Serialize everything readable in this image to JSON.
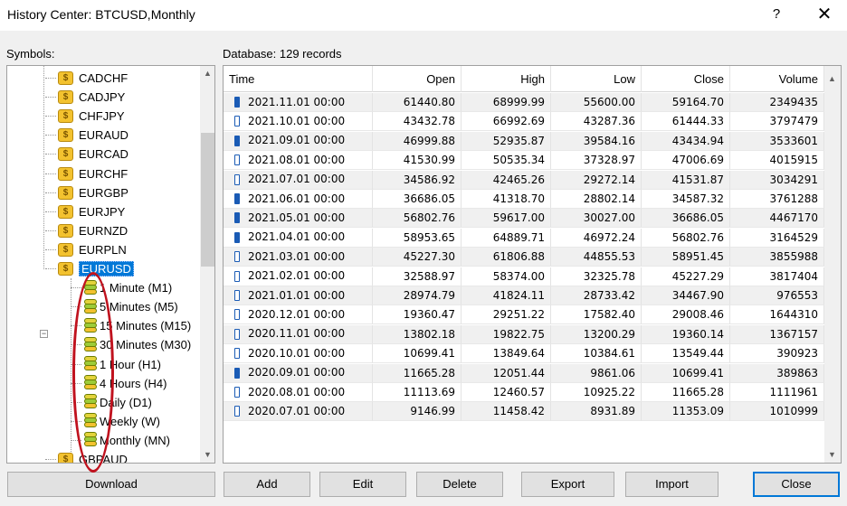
{
  "window": {
    "title": "History Center: BTCUSD,Monthly",
    "help_label": "?",
    "close_label": "✕"
  },
  "symbols_label": "Symbols:",
  "database_label": "Database: 129 records",
  "tree": {
    "symbols_above": [
      "CADCHF",
      "CADJPY",
      "CHFJPY",
      "EURAUD",
      "EURCAD",
      "EURCHF",
      "EURGBP",
      "EURJPY",
      "EURNZD",
      "EURPLN"
    ],
    "selected_symbol": "EURUSD",
    "timeframes": [
      "1 Minute (M1)",
      "5 Minutes (M5)",
      "15 Minutes (M15)",
      "30 Minutes (M30)",
      "1 Hour (H1)",
      "4 Hours (H4)",
      "Daily (D1)",
      "Weekly (W)",
      "Monthly (MN)"
    ],
    "symbol_below": "GBPAUD",
    "coin_glyph": "$",
    "expander_glyph": "−",
    "scroll_up": "▲",
    "scroll_down": "▼"
  },
  "grid": {
    "columns": [
      "Time",
      "Open",
      "High",
      "Low",
      "Close",
      "Volume"
    ],
    "rows": [
      [
        "2021.11.01 00:00",
        "61440.80",
        "68999.99",
        "55600.00",
        "59164.70",
        "2349435"
      ],
      [
        "2021.10.01 00:00",
        "43432.78",
        "66992.69",
        "43287.36",
        "61444.33",
        "3797479"
      ],
      [
        "2021.09.01 00:00",
        "46999.88",
        "52935.87",
        "39584.16",
        "43434.94",
        "3533601"
      ],
      [
        "2021.08.01 00:00",
        "41530.99",
        "50535.34",
        "37328.97",
        "47006.69",
        "4015915"
      ],
      [
        "2021.07.01 00:00",
        "34586.92",
        "42465.26",
        "29272.14",
        "41531.87",
        "3034291"
      ],
      [
        "2021.06.01 00:00",
        "36686.05",
        "41318.70",
        "28802.14",
        "34587.32",
        "3761288"
      ],
      [
        "2021.05.01 00:00",
        "56802.76",
        "59617.00",
        "30027.00",
        "36686.05",
        "4467170"
      ],
      [
        "2021.04.01 00:00",
        "58953.65",
        "64889.71",
        "46972.24",
        "56802.76",
        "3164529"
      ],
      [
        "2021.03.01 00:00",
        "45227.30",
        "61806.88",
        "44855.53",
        "58951.45",
        "3855988"
      ],
      [
        "2021.02.01 00:00",
        "32588.97",
        "58374.00",
        "32325.78",
        "45227.29",
        "3817404"
      ],
      [
        "2021.01.01 00:00",
        "28974.79",
        "41824.11",
        "28733.42",
        "34467.90",
        "976553"
      ],
      [
        "2020.12.01 00:00",
        "19360.47",
        "29251.22",
        "17582.40",
        "29008.46",
        "1644310"
      ],
      [
        "2020.11.01 00:00",
        "13802.18",
        "19822.75",
        "13200.29",
        "19360.14",
        "1367157"
      ],
      [
        "2020.10.01 00:00",
        "10699.41",
        "13849.64",
        "10384.61",
        "13549.44",
        "390923"
      ],
      [
        "2020.09.01 00:00",
        "11665.28",
        "12051.44",
        "9861.06",
        "10699.41",
        "389863"
      ],
      [
        "2020.08.01 00:00",
        "11113.69",
        "12460.57",
        "10925.22",
        "11665.28",
        "1111961"
      ],
      [
        "2020.07.01 00:00",
        "9146.99",
        "11458.42",
        "8931.89",
        "11353.09",
        "1010999"
      ]
    ],
    "scroll_up": "▲",
    "scroll_down": "▼"
  },
  "buttons": {
    "download": "Download",
    "add": "Add",
    "edit": "Edit",
    "delete": "Delete",
    "export": "Export",
    "import": "Import",
    "close": "Close"
  },
  "colors": {
    "selection": "#0078d7",
    "annotation": "#c0121e",
    "candle": "#1a5bb5"
  }
}
